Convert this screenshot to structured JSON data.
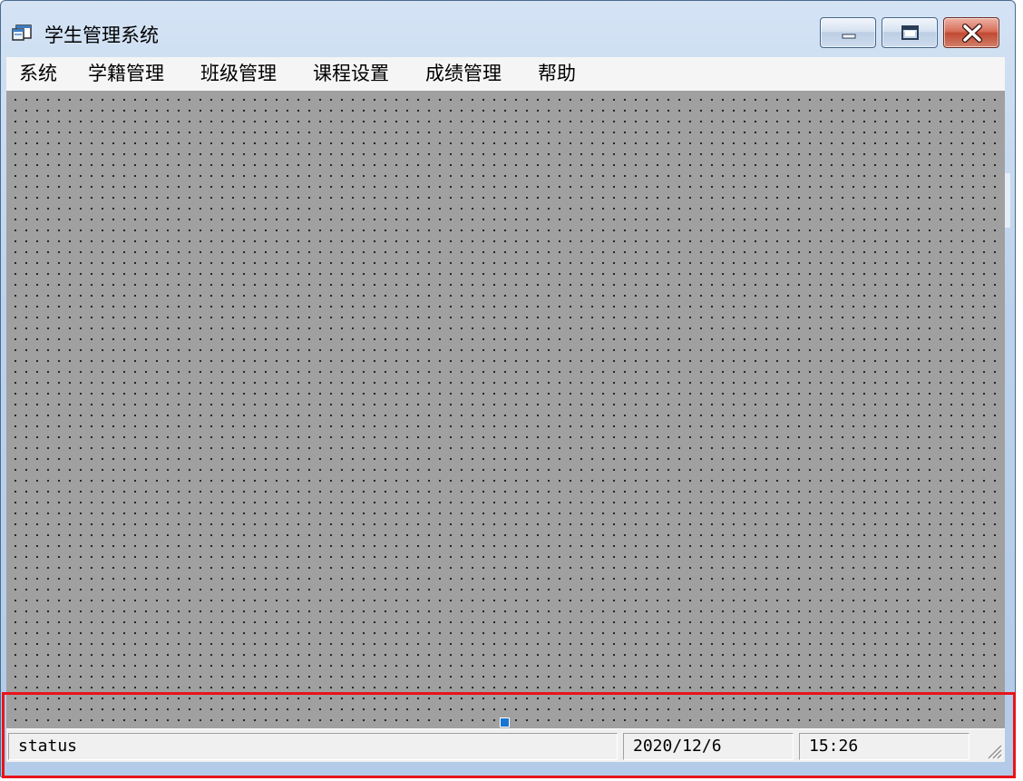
{
  "window": {
    "title": "学生管理系统",
    "app_icon": "form-app-icon",
    "controls": {
      "minimize_icon": "minimize-icon",
      "maximize_icon": "maximize-icon",
      "close_icon": "close-icon"
    }
  },
  "menu": {
    "items": [
      {
        "label": "系统"
      },
      {
        "label": "学籍管理"
      },
      {
        "label": "班级管理"
      },
      {
        "label": "课程设置"
      },
      {
        "label": "成绩管理"
      },
      {
        "label": "帮助"
      }
    ]
  },
  "statusbar": {
    "panels": [
      {
        "text": "status"
      },
      {
        "text": "2020/12/6"
      },
      {
        "text": "15:26"
      }
    ],
    "grip_icon": "resize-grip-icon"
  },
  "colors": {
    "mdi_background": "#a0a0a0",
    "menubar_background": "#f5f5f5",
    "statusbar_background": "#f0f0f0",
    "highlight": "#e8141a",
    "selection_handle": "#1874d2"
  }
}
